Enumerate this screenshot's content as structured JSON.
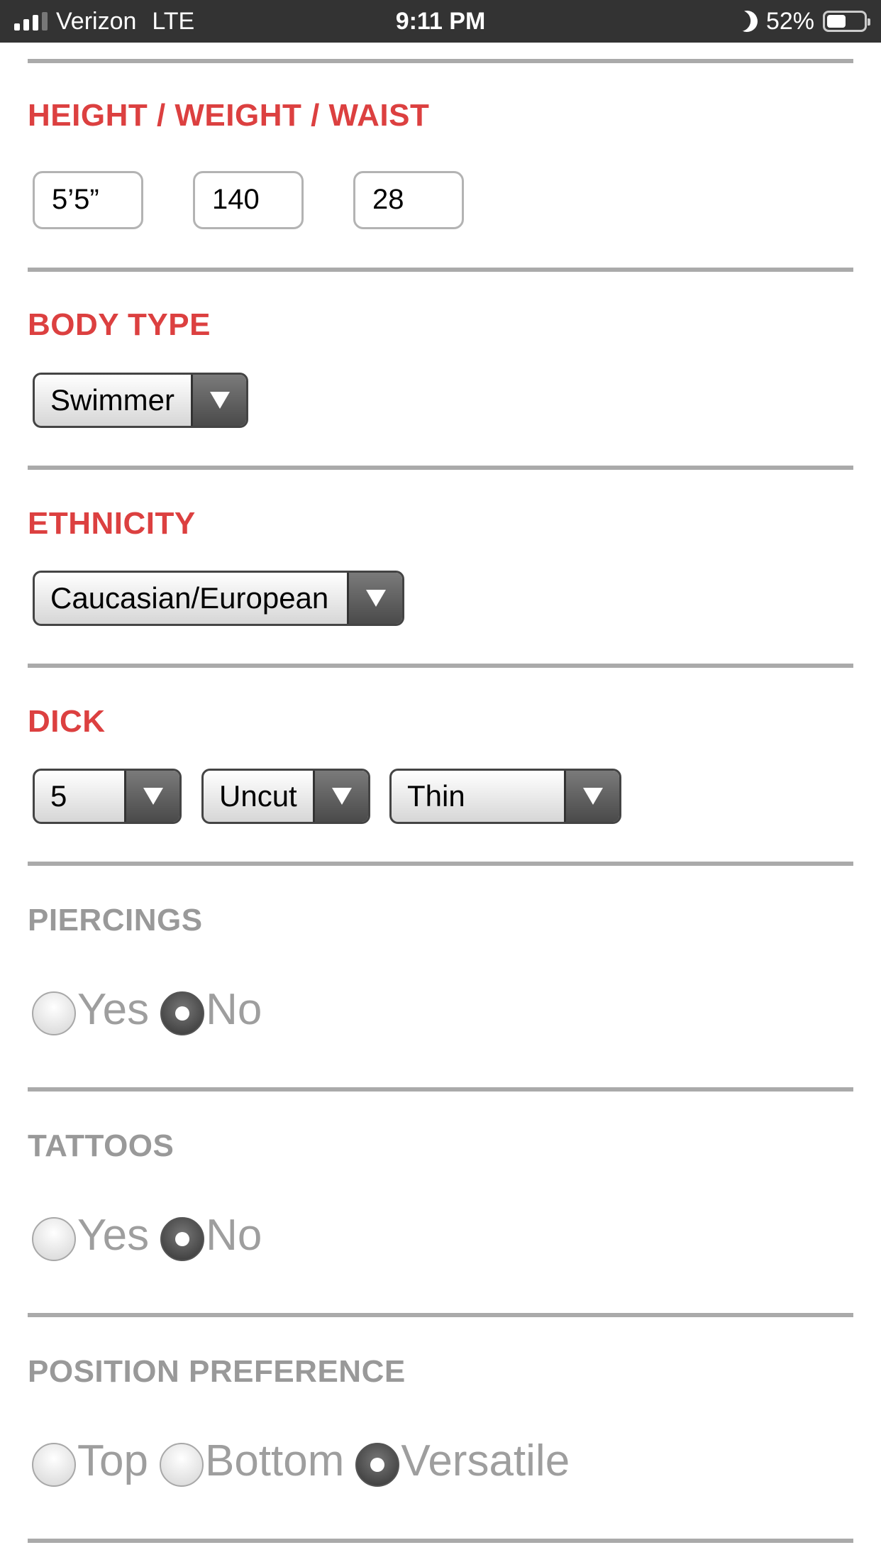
{
  "status_bar": {
    "carrier": "Verizon",
    "network": "LTE",
    "time": "9:11 PM",
    "battery": "52%",
    "battery_level": 0.52,
    "icons": [
      "signal-icon",
      "moon-icon",
      "battery-icon"
    ]
  },
  "colors": {
    "section_active": "#dc4040",
    "section_inactive": "#999999",
    "divider": "#aaaaaa"
  },
  "height_weight_waist": {
    "label": "HEIGHT / WEIGHT / WAIST",
    "height": "5’5”",
    "weight": "140",
    "waist": "28"
  },
  "body_type": {
    "label": "BODY TYPE",
    "selected": "Swimmer"
  },
  "ethnicity": {
    "label": "ETHNICITY",
    "selected": "Caucasian/European"
  },
  "dick": {
    "label": "DICK",
    "size": "5",
    "cut": "Uncut",
    "girth": "Thin"
  },
  "piercings": {
    "label": "PIERCINGS",
    "options": [
      "Yes",
      "No"
    ],
    "selected": "No"
  },
  "tattoos": {
    "label": "TATTOOS",
    "options": [
      "Yes",
      "No"
    ],
    "selected": "No"
  },
  "position_preference": {
    "label": "POSITION PREFERENCE",
    "options": [
      "Top",
      "Bottom",
      "Versatile"
    ],
    "selected": "Versatile"
  }
}
